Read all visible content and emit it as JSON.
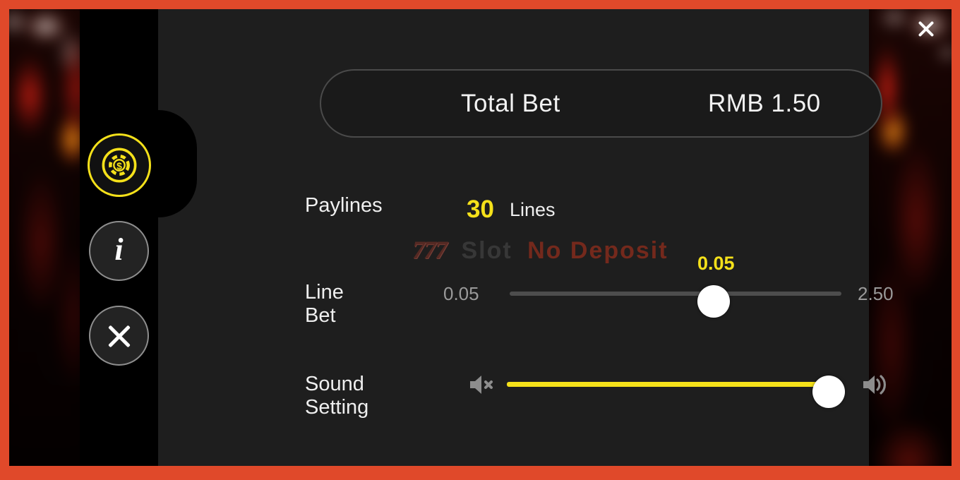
{
  "theme": {
    "frame_color": "#e0492a",
    "panel_bg": "#1e1e1e",
    "sidebar_bg": "#000000",
    "accent_yellow": "#f5e11a",
    "text_primary": "#efefef",
    "text_muted": "#9a9a9a"
  },
  "window": {
    "close_icon": "close-icon"
  },
  "sidebar": {
    "items": [
      {
        "id": "bet-settings",
        "icon": "casino-chip-icon",
        "selected": true
      },
      {
        "id": "game-info",
        "icon": "info-icon",
        "selected": false
      },
      {
        "id": "close-menu",
        "icon": "close-icon",
        "selected": false
      }
    ]
  },
  "total_bet": {
    "label": "Total Bet",
    "value": "RMB 1.50"
  },
  "paylines": {
    "label": "Paylines",
    "count": "30",
    "unit": "Lines"
  },
  "line_bet": {
    "label": "Line Bet",
    "min": "0.05",
    "max": "2.50",
    "current": "0.05",
    "fill_percent": 0
  },
  "sound": {
    "label": "Sound Setting",
    "mute_icon": "speaker-mute-icon",
    "loud_icon": "speaker-loud-icon",
    "fill_percent": 100
  },
  "watermark": {
    "logo": "777",
    "word1": "Slot",
    "word2": "No Deposit"
  }
}
